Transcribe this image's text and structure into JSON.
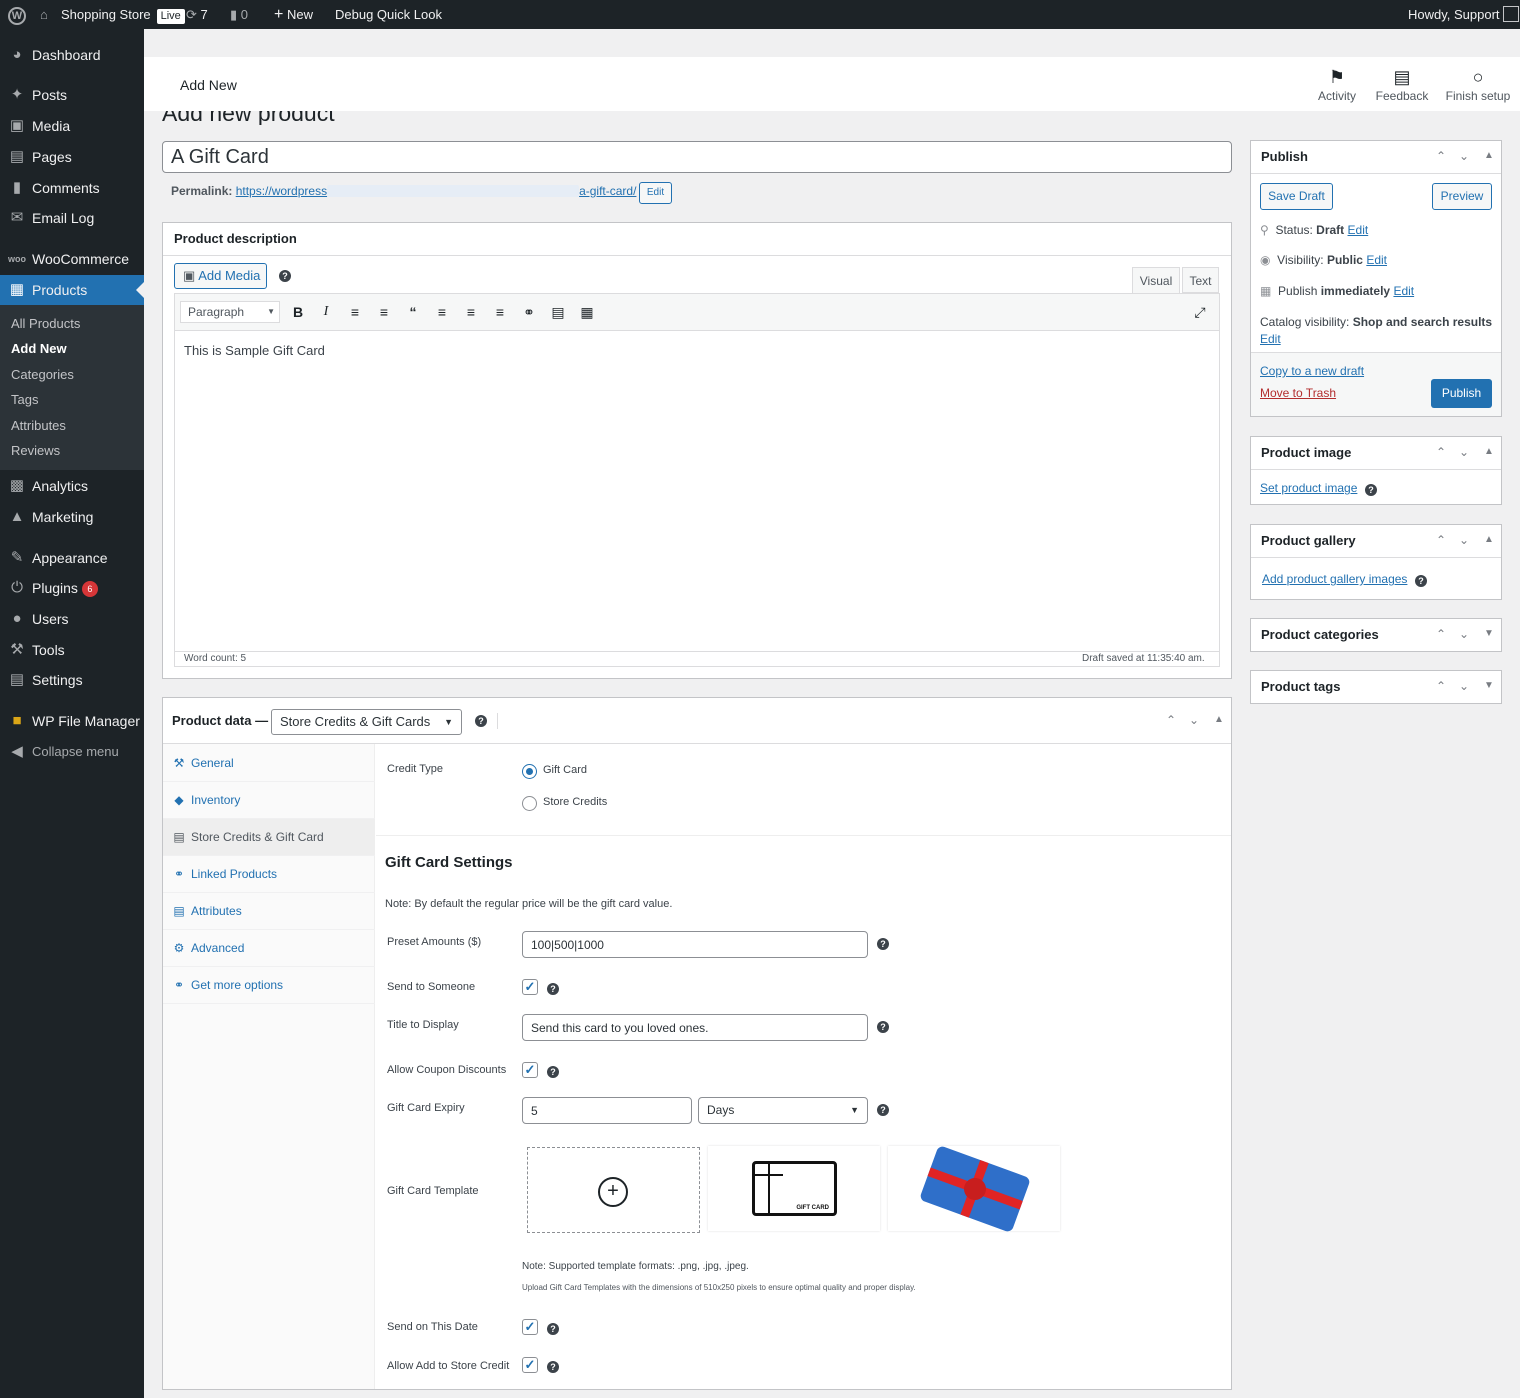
{
  "adminbar": {
    "site_name": "Shopping Store",
    "live_label": "Live",
    "updates_count": "7",
    "comments_count": "0",
    "new_label": "New",
    "debug_label": "Debug Quick Look",
    "howdy": "Howdy, Support"
  },
  "sidebar": {
    "items": [
      {
        "label": "Dashboard",
        "icon": "dashboard-icon"
      },
      {
        "label": "Posts",
        "icon": "pin-icon"
      },
      {
        "label": "Media",
        "icon": "media-icon"
      },
      {
        "label": "Pages",
        "icon": "pages-icon"
      },
      {
        "label": "Comments",
        "icon": "comments-icon"
      },
      {
        "label": "Email Log",
        "icon": "email-icon"
      },
      {
        "label": "WooCommerce",
        "icon": "woo-icon"
      },
      {
        "label": "Products",
        "icon": "archive-icon"
      },
      {
        "label": "Analytics",
        "icon": "bar-chart-icon"
      },
      {
        "label": "Marketing",
        "icon": "megaphone-icon"
      },
      {
        "label": "Appearance",
        "icon": "brush-icon"
      },
      {
        "label": "Plugins",
        "icon": "plug-icon",
        "badge": "6"
      },
      {
        "label": "Users",
        "icon": "user-icon"
      },
      {
        "label": "Tools",
        "icon": "wrench-icon"
      },
      {
        "label": "Settings",
        "icon": "sliders-icon"
      },
      {
        "label": "WP File Manager",
        "icon": "folder-icon"
      },
      {
        "label": "Collapse menu",
        "icon": "collapse-icon"
      }
    ],
    "submenu": [
      "All Products",
      "Add New",
      "Categories",
      "Tags",
      "Attributes",
      "Reviews"
    ]
  },
  "header": {
    "title": "Add New",
    "activity": "Activity",
    "feedback": "Feedback",
    "finish_setup": "Finish setup"
  },
  "page": {
    "heading": "Add new product",
    "title_value": "A Gift Card",
    "permalink_label": "Permalink:",
    "permalink_start": "https://wordpress",
    "permalink_slug": "a-gift-card/",
    "permalink_edit": "Edit"
  },
  "description": {
    "title": "Product description",
    "add_media": "Add Media",
    "tab_visual": "Visual",
    "tab_text": "Text",
    "format": "Paragraph",
    "content": "This is Sample Gift Card",
    "word_count": "Word count: 5",
    "draft_saved": "Draft saved at 11:35:40 am."
  },
  "product_data": {
    "title": "Product data —",
    "type": "Store Credits & Gift Cards",
    "tabs": [
      "General",
      "Inventory",
      "Store Credits & Gift Card",
      "Linked Products",
      "Attributes",
      "Advanced",
      "Get more options"
    ],
    "credit_type_label": "Credit Type",
    "credit_options": [
      "Gift Card",
      "Store Credits"
    ],
    "settings_title": "Gift Card Settings",
    "note": "Note: By default the regular price will be the gift card value.",
    "preset_label": "Preset Amounts ($)",
    "preset_value": "100|500|1000",
    "send_someone_label": "Send to Someone",
    "title_display_label": "Title to Display",
    "title_display_value": "Send this card to you loved ones.",
    "coupon_label": "Allow Coupon Discounts",
    "expiry_label": "Gift Card Expiry",
    "expiry_value": "5",
    "expiry_unit": "Days",
    "template_label": "Gift Card Template",
    "template_card_text": "GIFT CARD",
    "formats_note": "Note: Supported template formats: .png, .jpg, .jpeg.",
    "dimensions_note": "Upload Gift Card Templates with the dimensions of 510x250 pixels to ensure optimal quality and proper display.",
    "send_date_label": "Send on This Date",
    "store_credit_label": "Allow Add to Store Credit"
  },
  "publish": {
    "title": "Publish",
    "save_draft": "Save Draft",
    "preview": "Preview",
    "status_label": "Status:",
    "status_value": "Draft",
    "visibility_label": "Visibility:",
    "visibility_value": "Public",
    "publish_label": "Publish",
    "publish_value": "immediately",
    "edit": "Edit",
    "catalog_label": "Catalog visibility:",
    "catalog_value": "Shop and search results",
    "copy_draft": "Copy to a new draft",
    "trash": "Move to Trash",
    "publish_button": "Publish"
  },
  "product_image": {
    "title": "Product image",
    "link": "Set product image"
  },
  "product_gallery": {
    "title": "Product gallery",
    "link": "Add product gallery images"
  },
  "product_categories": {
    "title": "Product categories"
  },
  "product_tags": {
    "title": "Product tags"
  },
  "colors": {
    "accent": "#2271b1",
    "sidebar": "#1d2327",
    "trash": "#b32d2e",
    "badge": "#d63638"
  }
}
